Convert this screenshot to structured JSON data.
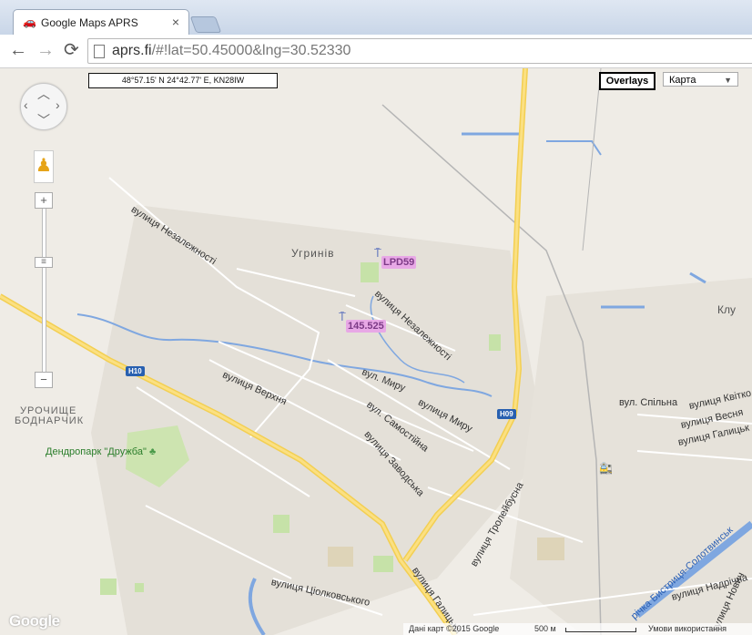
{
  "browser": {
    "tab_title": "Google Maps APRS",
    "tab_icon": "car-icon",
    "close_glyph": "×",
    "url_host": "aprs.fi",
    "url_rest": "/#!lat=50.45000&lng=30.52330",
    "back_icon": "←",
    "forward_icon": "→",
    "reload_icon": "⟳"
  },
  "map": {
    "coords_readout": "48°57.15' N 24°42.77' E, KN28IW",
    "overlays_label": "Overlays",
    "map_type": "Карта",
    "zoom_in": "+",
    "zoom_out": "−",
    "stations": [
      {
        "callsign": "LPD59"
      },
      {
        "callsign": "145.525"
      }
    ],
    "place_labels": {
      "village": "Угринів",
      "klu": "Клу",
      "urochyshche_1": "УРОЧИЩЕ",
      "urochyshche_2": "БОДНАРЧИК",
      "dendropark": "Дендропарк \"Дружба\""
    },
    "street_labels": {
      "nezalezhnosti_1": "вулиця Незалежності",
      "nezalezhnosti_2": "вулиця Незалежності",
      "verkhnia": "вулиця Верхня",
      "myru_1": "вул. Миру",
      "myru_2": "вулиця Миру",
      "samostiina": "вул. Самостійна",
      "zavodska": "вулиця Заводська",
      "galytska": "вулиця Галицька",
      "tsiolkovskoho": "вулиця Ціолковського",
      "troleibusna": "вулиця Тролейбусна",
      "spilna": "вул. Спільна",
      "kvitkova": "вулиця Квітко",
      "vesniana": "вулиця Весня",
      "galytska_2": "вулиця Галицьк",
      "nadrichna": "вулиця Надрічна",
      "novych": "вулиця Нович",
      "bystrytsia": "річка Бистриця-Солотвинськ"
    },
    "road_shields": {
      "h10": "H10",
      "h09": "H09"
    },
    "footer": {
      "data": "Дані карт ©2015 Google",
      "scale": "500 м",
      "terms": "Умови використання"
    },
    "logo": "Google"
  }
}
